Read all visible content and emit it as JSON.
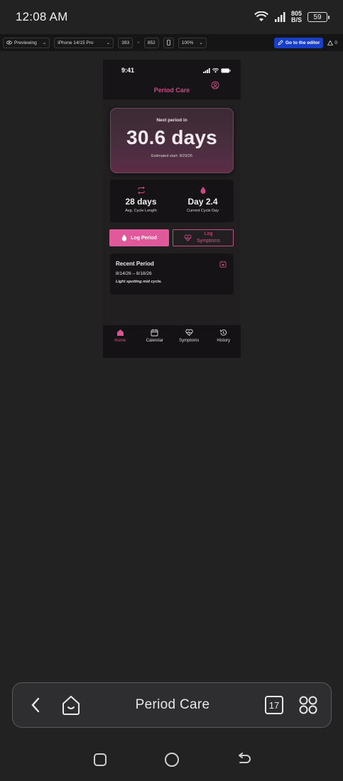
{
  "status_bar": {
    "time": "12:08 AM",
    "net_speed_value": "805",
    "net_speed_unit": "B/S",
    "battery": "59"
  },
  "toolbar": {
    "mode": "Previewing",
    "device": "iPhone 14/15 Pro",
    "width": "393",
    "height": "852",
    "zoom": "100%",
    "editor_button": "Go to the editor",
    "warnings": "0"
  },
  "phone": {
    "ios_time": "9:41",
    "app_title": "Period Care",
    "hero": {
      "label": "Next period in",
      "value": "30.6 days",
      "estimated": "Estimated start: 8/29/26"
    },
    "stats": [
      {
        "icon": "repeat-icon",
        "value": "28 days",
        "label": "Avg. Cycle Length"
      },
      {
        "icon": "drop-icon",
        "value": "Day 2.4",
        "label": "Current Cycle Day"
      }
    ],
    "actions": {
      "log_period": "Log Period",
      "log_symptoms": "Log Symptoms"
    },
    "recent": {
      "title": "Recent Period",
      "dates": "8/14/26 – 8/18/26",
      "note": "Light spotting mid cycle."
    },
    "tabs": [
      {
        "label": "Home",
        "icon": "home-icon",
        "active": true
      },
      {
        "label": "Calendar",
        "icon": "calendar-icon",
        "active": false
      },
      {
        "label": "Symptoms",
        "icon": "heart-pulse-icon",
        "active": false
      },
      {
        "label": "History",
        "icon": "history-icon",
        "active": false
      }
    ]
  },
  "browser": {
    "title": "Period Care",
    "tab_count": "17"
  },
  "colors": {
    "accent": "#e0599a",
    "accent_text": "#c94a86",
    "background": "#232223",
    "card": "#151315"
  }
}
